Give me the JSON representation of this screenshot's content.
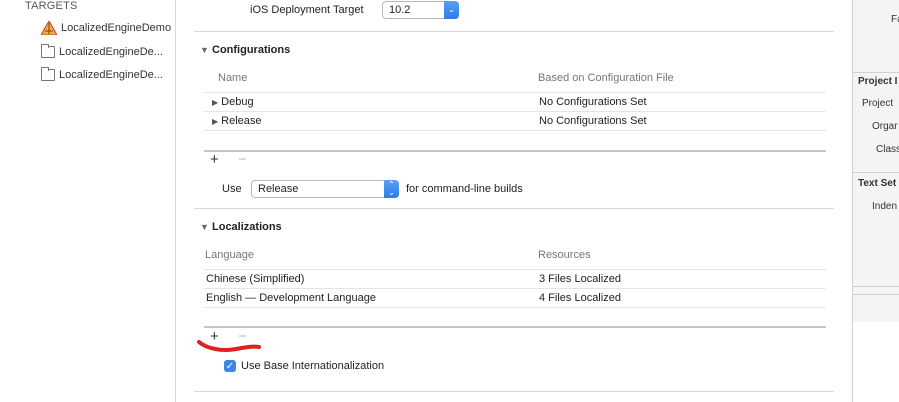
{
  "targets": {
    "heading": "TARGETS",
    "items": [
      {
        "label": "LocalizedEngineDemo",
        "icon": "app-icon"
      },
      {
        "label": "LocalizedEngineDe...",
        "icon": "folder-icon"
      },
      {
        "label": "LocalizedEngineDe...",
        "icon": "folder-icon"
      }
    ]
  },
  "deployment": {
    "label": "iOS Deployment Target",
    "value": "10.2"
  },
  "configurations": {
    "title": "Configurations",
    "columns": [
      "Name",
      "Based on Configuration File"
    ],
    "rows": [
      {
        "name": "Debug",
        "file": "No Configurations Set"
      },
      {
        "name": "Release",
        "file": "No Configurations Set"
      }
    ],
    "add_label": "+",
    "remove_label": "−",
    "use_label": "Use",
    "use_value": "Release",
    "use_suffix": "for command-line builds"
  },
  "localizations": {
    "title": "Localizations",
    "columns": [
      "Language",
      "Resources"
    ],
    "rows": [
      {
        "language": "Chinese (Simplified)",
        "resources": "3 Files Localized"
      },
      {
        "language": "English — Development Language",
        "resources": "4 Files Localized"
      }
    ],
    "add_label": "+",
    "remove_label": "−",
    "base_intl_label": "Use Base Internationalization",
    "base_intl_checked": true
  },
  "inspector": {
    "fa_label": "Fa",
    "project_doc_heading": "Project I",
    "project_label": "Project",
    "organization_label": "Orgar",
    "class_label": "Class",
    "text_settings_heading": "Text Set",
    "indent_label": "Inden"
  },
  "colors": {
    "annotation": "#e0201c",
    "accent": "#3b86e8"
  }
}
